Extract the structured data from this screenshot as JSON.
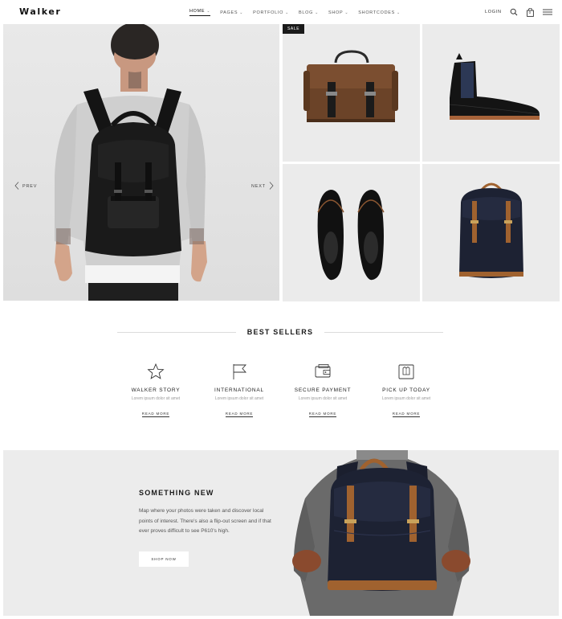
{
  "brand": {
    "logo": "Walker"
  },
  "nav": {
    "items": [
      {
        "label": "HOME",
        "active": true
      },
      {
        "label": "PAGES"
      },
      {
        "label": "PORTFOLIO"
      },
      {
        "label": "BLOG"
      },
      {
        "label": "SHOP"
      },
      {
        "label": "SHORTCODES"
      }
    ],
    "login": "LOGIN",
    "cart_count": "0",
    "icons": [
      "search-icon",
      "cart-icon",
      "menu-icon"
    ]
  },
  "hero": {
    "prev": "PREV",
    "next": "NEXT",
    "sale_badge": "SALE"
  },
  "best_sellers": {
    "title": "BEST SELLERS",
    "features": [
      {
        "icon": "star-icon",
        "title": "WALKER STORY",
        "desc": "Lorem ipsum dolor sit amet",
        "more": "READ MORE"
      },
      {
        "icon": "flag-icon",
        "title": "INTERNATIONAL",
        "desc": "Lorem ipsum dolor sit amet",
        "more": "READ MORE"
      },
      {
        "icon": "wallet-icon",
        "title": "SECURE PAYMENT",
        "desc": "Lorem ipsum dolor sit amet",
        "more": "READ MORE"
      },
      {
        "icon": "shirt-box-icon",
        "title": "PICK UP TODAY",
        "desc": "Lorem ipsum dolor sit amet",
        "more": "READ MORE"
      }
    ]
  },
  "promo": {
    "title": "SOMETHING NEW",
    "body": "Map where your photos were taken and discover local points of interest. There's also a flip-out screen and if that ever proves difficult to see P610's high.",
    "button": "SHOP NOW"
  },
  "colors": {
    "accent": "#1a1a1a",
    "muted": "#999999",
    "panel": "#ececec",
    "leather": "#a0622f",
    "navy": "#1d2233"
  }
}
